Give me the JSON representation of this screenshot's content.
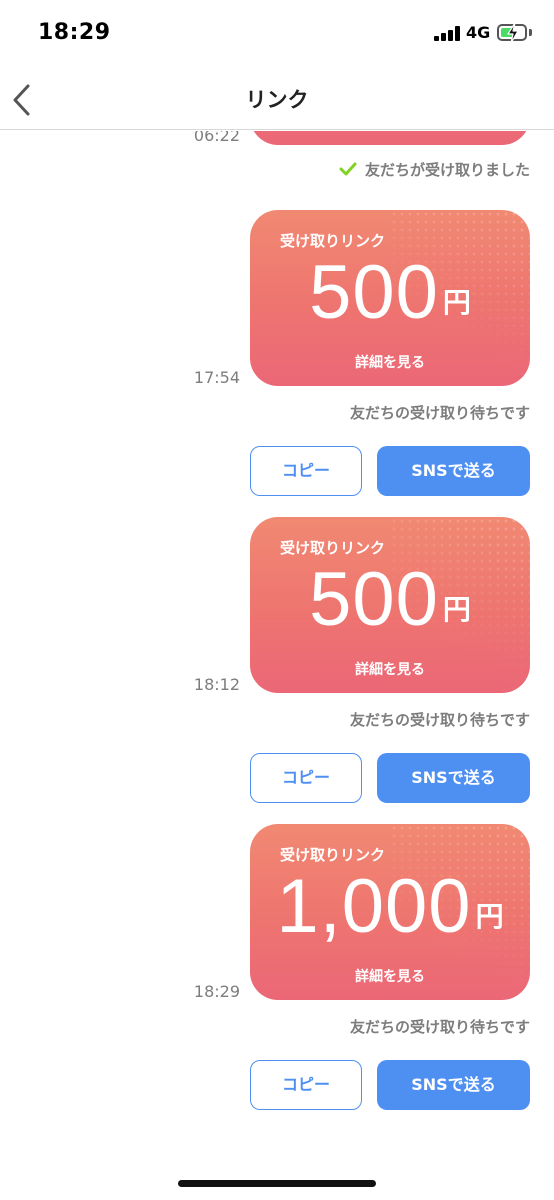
{
  "status_bar": {
    "time": "18:29",
    "network": "4G",
    "battery_level": 0.6,
    "battery_color": "#4cd964"
  },
  "nav": {
    "back_icon": "chevron-left-icon",
    "title": "リンク"
  },
  "top_partial": {
    "time": "06:22",
    "status": "友だちが受け取りました",
    "status_icon": "checkmark-icon",
    "status_icon_color": "#7ed321"
  },
  "links": [
    {
      "label": "受け取りリンク",
      "amount": "500",
      "currency": "円",
      "detail": "詳細を見る",
      "time": "17:54",
      "status": "友だちの受け取り待ちです",
      "copy_label": "コピー",
      "sns_label": "SNSで送る"
    },
    {
      "label": "受け取りリンク",
      "amount": "500",
      "currency": "円",
      "detail": "詳細を見る",
      "time": "18:12",
      "status": "友だちの受け取り待ちです",
      "copy_label": "コピー",
      "sns_label": "SNSで送る"
    },
    {
      "label": "受け取りリンク",
      "amount": "1,000",
      "currency": "円",
      "detail": "詳細を見る",
      "time": "18:29",
      "status": "友だちの受け取り待ちです",
      "copy_label": "コピー",
      "sns_label": "SNSで送る"
    }
  ],
  "colors": {
    "card_gradient_top": "#f18972",
    "card_gradient_bottom": "#eb6777",
    "accent_blue": "#4e8ff2"
  }
}
